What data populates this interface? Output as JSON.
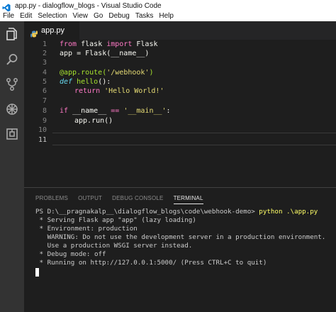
{
  "window": {
    "title": "app.py - dialogflow_blogs - Visual Studio Code"
  },
  "menu": [
    "File",
    "Edit",
    "Selection",
    "View",
    "Go",
    "Debug",
    "Tasks",
    "Help"
  ],
  "activity_icons": [
    "files-icon",
    "search-icon",
    "source-control-icon",
    "debug-icon",
    "extensions-icon"
  ],
  "editor": {
    "tab_label": "app.py",
    "line_numbers": [
      "1",
      "2",
      "3",
      "4",
      "5",
      "6",
      "7",
      "8",
      "9",
      "10",
      "11"
    ],
    "active_line": "11"
  },
  "code_tokens": {
    "l1_from": "from",
    "l1_mod": " flask ",
    "l1_import": "import",
    "l1_cls": " Flask",
    "l2": "app = Flask(__name__)",
    "l4_dec": "@app.route(",
    "l4_str": "'/webhook'",
    "l4_end": ")",
    "l5_def": "def",
    "l5_fn": " hello",
    "l5_end": "():",
    "l6_ret": "return",
    "l6_str": " 'Hello World!'",
    "l8_if": "if",
    "l8_name": " __name__ ",
    "l8_eq": "==",
    "l8_str": " '__main__'",
    "l8_end": ":",
    "l9": "app.run()"
  },
  "panel": {
    "tabs": [
      "PROBLEMS",
      "OUTPUT",
      "DEBUG CONSOLE",
      "TERMINAL"
    ],
    "active_tab": "TERMINAL"
  },
  "terminal": {
    "prompt": "PS D:\\__pragnakalp__\\dialogflow_blogs\\code\\webhook-demo>",
    "command": " python .\\app.py",
    "lines": [
      " * Serving Flask app \"app\" (lazy loading)",
      " * Environment: production",
      "   WARNING: Do not use the development server in a production environment.",
      "   Use a production WSGI server instead.",
      " * Debug mode: off",
      " * Running on http://127.0.0.1:5000/ (Press CTRL+C to quit)"
    ]
  },
  "colors": {
    "editor_bg": "#1e1e1e",
    "activity_bar": "#333333",
    "keyword": "#ff79c6",
    "function": "#a6e22e",
    "string": "#e6db74",
    "def_keyword": "#66d9ef",
    "vscode_blue": "#0078d4"
  }
}
